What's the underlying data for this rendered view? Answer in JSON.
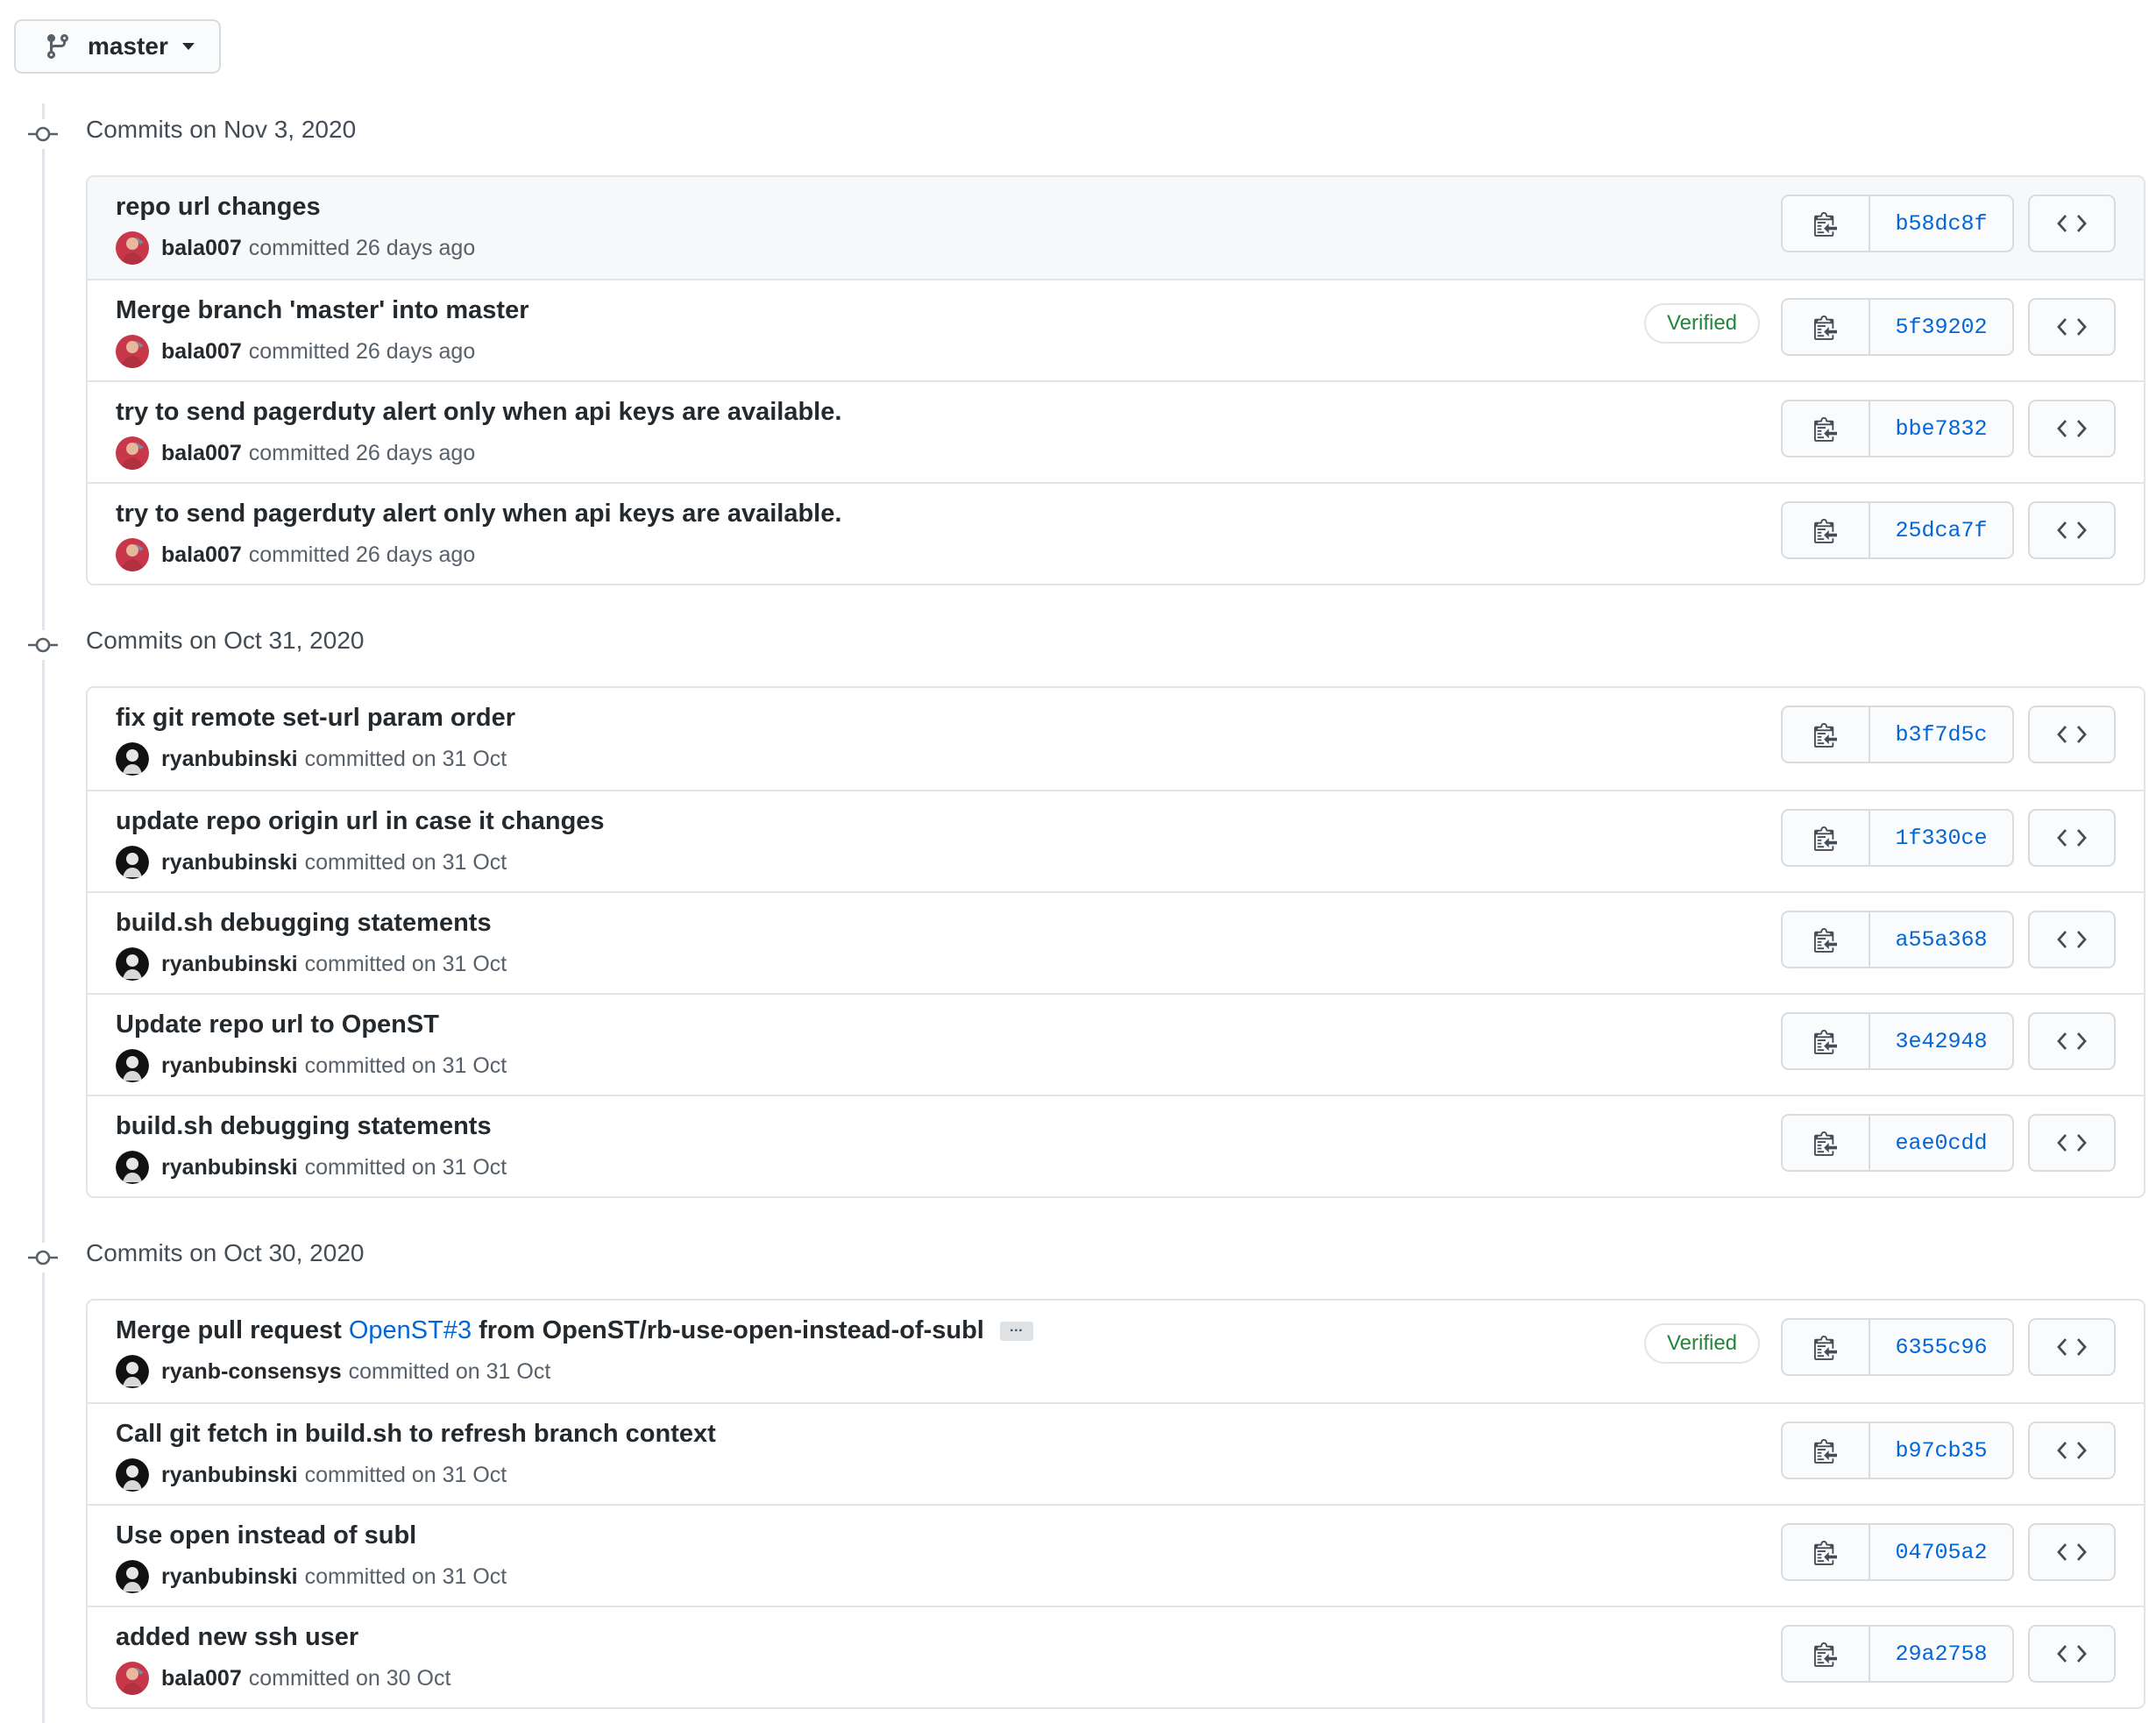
{
  "branch": {
    "label": "master"
  },
  "groups": [
    {
      "title": "Commits on Nov 3, 2020",
      "commits": [
        {
          "message": "repo url changes",
          "author": "bala007",
          "action": "committed 26 days ago",
          "sha": "b58dc8f"
        },
        {
          "message": "Merge branch 'master' into master",
          "author": "bala007",
          "action": "committed 26 days ago",
          "sha": "5f39202",
          "badge": "Verified"
        },
        {
          "message": "try to send pagerduty alert only when api keys are available.",
          "author": "bala007",
          "action": "committed 26 days ago",
          "sha": "bbe7832"
        },
        {
          "message": "try to send pagerduty alert only when api keys are available.",
          "author": "bala007",
          "action": "committed 26 days ago",
          "sha": "25dca7f"
        }
      ]
    },
    {
      "title": "Commits on Oct 31, 2020",
      "commits": [
        {
          "message": "fix git remote set-url param order",
          "author": "ryanbubinski",
          "action": "committed on 31 Oct",
          "sha": "b3f7d5c"
        },
        {
          "message": "update repo origin url in case it changes",
          "author": "ryanbubinski",
          "action": "committed on 31 Oct",
          "sha": "1f330ce"
        },
        {
          "message": "build.sh debugging statements",
          "author": "ryanbubinski",
          "action": "committed on 31 Oct",
          "sha": "a55a368"
        },
        {
          "message": "Update repo url to OpenST",
          "author": "ryanbubinski",
          "action": "committed on 31 Oct",
          "sha": "3e42948"
        },
        {
          "message": "build.sh debugging statements",
          "author": "ryanbubinski",
          "action": "committed on 31 Oct",
          "sha": "eae0cdd"
        }
      ]
    },
    {
      "title": "Commits on Oct 30, 2020",
      "commits": [
        {
          "message_prefix": "Merge pull request",
          "message_link": "OpenST#3",
          "message_suffix": "from OpenST/rb-use-open-instead-of-subl",
          "ellipsis": "…",
          "author": "ryanb-consensys",
          "action": "committed on 31 Oct",
          "sha": "6355c96",
          "badge": "Verified"
        },
        {
          "message": "Call git fetch in build.sh to refresh branch context",
          "author": "ryanbubinski",
          "action": "committed on 31 Oct",
          "sha": "b97cb35"
        },
        {
          "message": "Use open instead of subl",
          "author": "ryanbubinski",
          "action": "committed on 31 Oct",
          "sha": "04705a2"
        },
        {
          "message": "added new ssh user",
          "author": "bala007",
          "action": "committed on 30 Oct",
          "sha": "29a2758"
        }
      ]
    }
  ],
  "icons": {
    "branch": "git-branch-icon",
    "commit": "git-commit-icon",
    "copy": "clipboard-icon",
    "browse": "code-icon"
  },
  "colors": {
    "link": "#0366d6",
    "verified": "#22863a",
    "highlight_row": "#f6f8fa"
  }
}
